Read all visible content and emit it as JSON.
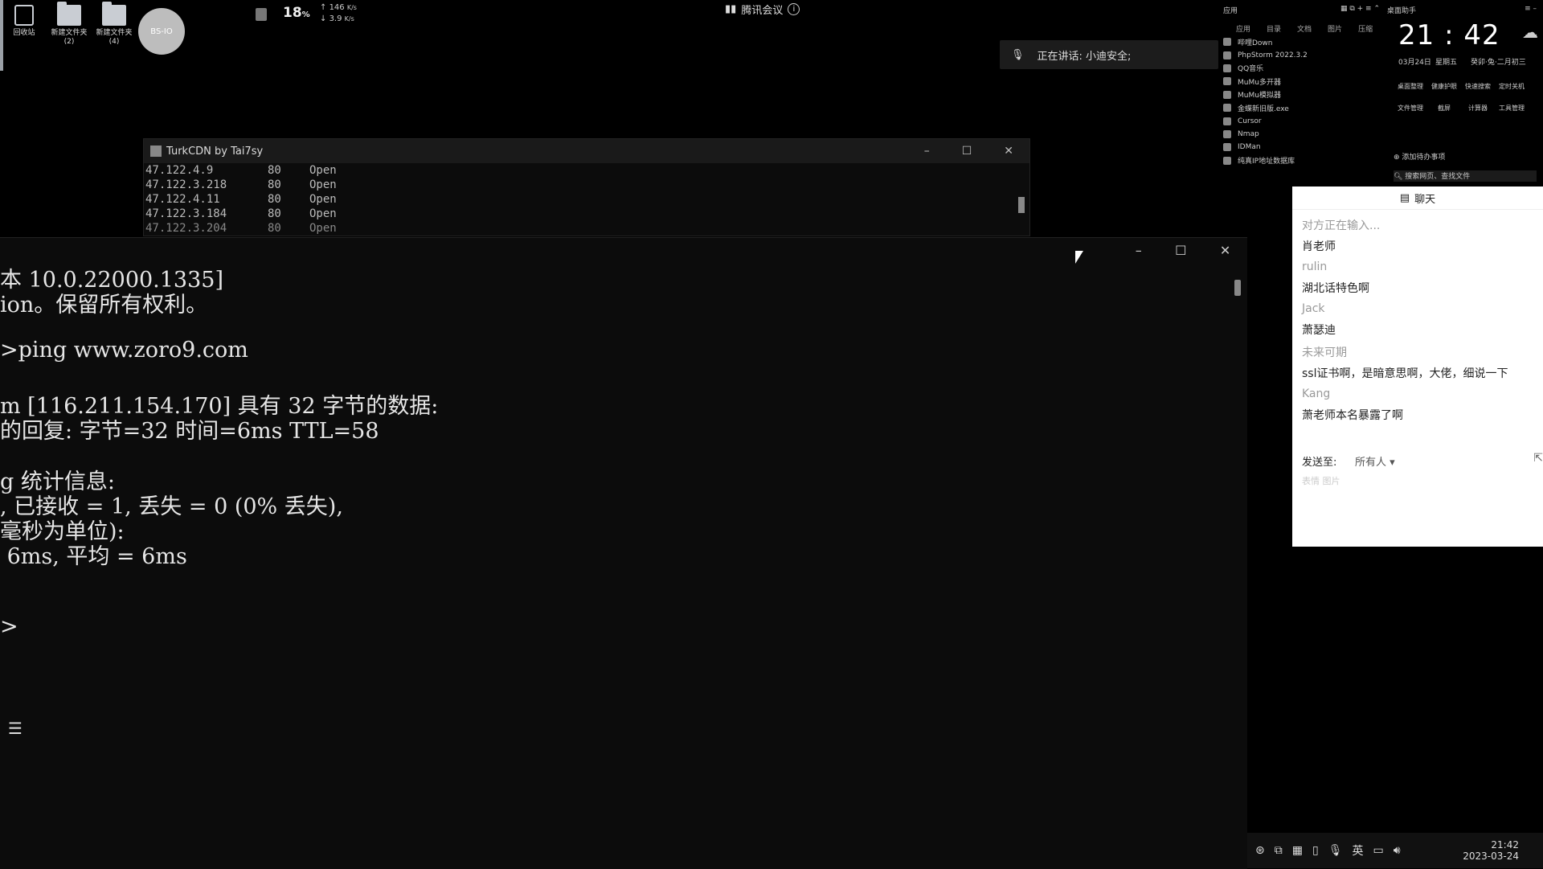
{
  "desktop": {
    "icons": [
      {
        "label": "回收站",
        "sub": ""
      },
      {
        "label": "新建文件夹",
        "sub": "(2)"
      },
      {
        "label": "新建文件夹",
        "sub": "(4)"
      }
    ],
    "avatar_text": "BS-IO"
  },
  "sysmon": {
    "cpu": "18",
    "cpu_unit": "%",
    "up": "146",
    "down": "3.9",
    "rate_unit": "K/s"
  },
  "meeting": {
    "title": "腾讯会议",
    "speaking_label": "正在讲话: 小迪安全;"
  },
  "applist": {
    "header": "应用",
    "tabs": [
      "应用",
      "目录",
      "文档",
      "图片",
      "压缩"
    ],
    "items": [
      "哔哩Down",
      "PhpStorm 2022.3.2",
      "QQ音乐",
      "MuMu多开器",
      "MuMu模拟器",
      "金蝶新旧版.exe",
      "Cursor",
      "Nmap",
      "IDMan",
      "纯真IP地址数据库"
    ]
  },
  "clock": {
    "header": "桌面助手",
    "time": "21 : 42",
    "date": "03月24日",
    "weekday": "星期五",
    "lunar": "癸卯·兔·二月初三",
    "tools": [
      "桌面整理",
      "健康护眼",
      "快速搜索",
      "定时关机",
      "文件管理",
      "截屏",
      "计算器",
      "工具管理"
    ],
    "todo": "添加待办事项",
    "search_placeholder": "搜索网页、查找文件"
  },
  "turk": {
    "title": "TurkCDN by Tai7sy",
    "rows": [
      {
        "ip": "47.122.4.9",
        "port": "80",
        "status": "Open"
      },
      {
        "ip": "47.122.3.218",
        "port": "80",
        "status": "Open"
      },
      {
        "ip": "47.122.4.11",
        "port": "80",
        "status": "Open"
      },
      {
        "ip": "47.122.3.184",
        "port": "80",
        "status": "Open"
      },
      {
        "ip": "47.122.3.204",
        "port": "80",
        "status": "Open"
      }
    ]
  },
  "terminal": {
    "lines": [
      "本 10.0.22000.1335]",
      "ion。保留所有权利。",
      ">ping www.zoro9.com",
      "m [116.211.154.170] 具有 32 字节的数据:",
      "的回复: 字节=32 时间=6ms TTL=58",
      "g 统计信息:",
      ", 已接收 = 1, 丢失 = 0 (0% 丢失),",
      "毫秒为单位):",
      " 6ms, 平均 = 6ms",
      ">"
    ]
  },
  "chat": {
    "title": "聊天",
    "typing": "对方正在输入...",
    "messages": [
      {
        "name": "",
        "text": "肖老师"
      },
      {
        "name": "rulin",
        "text": "湖北话特色啊"
      },
      {
        "name": "Jack",
        "text": "萧瑟迪"
      },
      {
        "name": "未来可期",
        "text": "ssl证书啊，是暗意思啊，大佬，细说一下"
      },
      {
        "name": "Kang",
        "text": "萧老师本名暴露了啊"
      }
    ],
    "send_to_label": "发送至:",
    "send_to_value": "所有人",
    "tools_hint": "表情   图片"
  },
  "tray": {
    "ime": "英",
    "time": "21:42",
    "date": "2023-03-24"
  }
}
